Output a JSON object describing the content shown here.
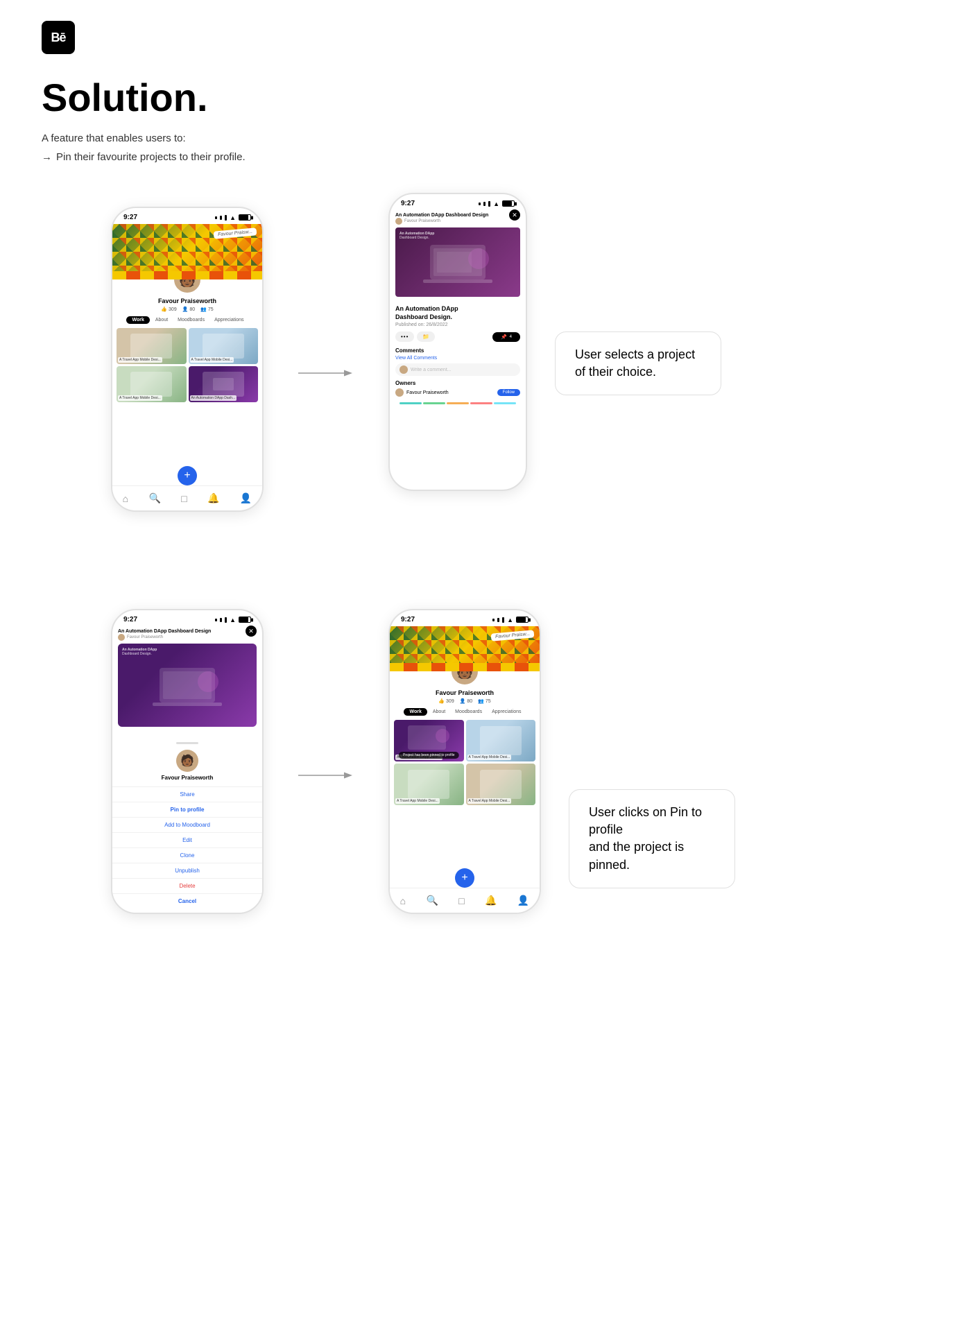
{
  "header": {
    "logo_text": "Bē"
  },
  "solution": {
    "title": "Solution.",
    "description_prefix": "A feature that enables users to:",
    "bullet_arrow": "→",
    "bullet_text": "Pin their favourite projects to their profile."
  },
  "row1": {
    "profile_phone": {
      "time": "9:27",
      "user_name": "Favour Praiseworth",
      "name_tag": "Favour Praisw...",
      "stats": "309  •  80  •  75",
      "tabs": [
        "Work",
        "About",
        "Moodboards",
        "Appreciations"
      ],
      "projects": [
        {
          "label": "A Travel App Mobile Desi..."
        },
        {
          "label": "A Travel App Mobile Desi..."
        },
        {
          "label": "A Travel App Mobile Desi..."
        },
        {
          "label": "An Automation DApp Dash..."
        }
      ]
    },
    "detail_phone": {
      "time": "9:27",
      "title": "An Automation DApp Dashboard Design",
      "project_title": "An Automation DApp Dashboard Design.",
      "published": "Published on: 26/8/2022",
      "comments_label": "Comments",
      "view_comments": "View All Comments",
      "comment_placeholder": "Write a comment...",
      "owners_label": "Owners",
      "owner_name": "Favour Praiseworth"
    },
    "callout": "User selects a project of their choice."
  },
  "row2": {
    "sheet_phone": {
      "time": "9:27",
      "project_title": "An Automation DApp Dashboard Design",
      "owner": "Favour Praiseworth",
      "user_name": "Favour Praiseworth",
      "actions": [
        "Share",
        "Pin to profile",
        "Add to Moodboard",
        "Edit",
        "Clone",
        "Unpublish"
      ],
      "delete_action": "Delete",
      "cancel_action": "Cancel"
    },
    "pinned_phone": {
      "time": "9:27",
      "user_name": "Favour Praiseworth",
      "stats": "309  •  80  •  75",
      "tabs": [
        "Work",
        "About",
        "Moodboards",
        "Appreciations"
      ],
      "toast": "Project has been pinned to profile",
      "projects": [
        {
          "label": "An Automation DApp Dash..."
        },
        {
          "label": "A Travel App Mobile Desi..."
        },
        {
          "label": "A Travel App Mobile Desi..."
        },
        {
          "label": "A Travel App Mobile Desi..."
        }
      ]
    },
    "callout": "User clicks on Pin to profile\nand the project is pinned."
  }
}
